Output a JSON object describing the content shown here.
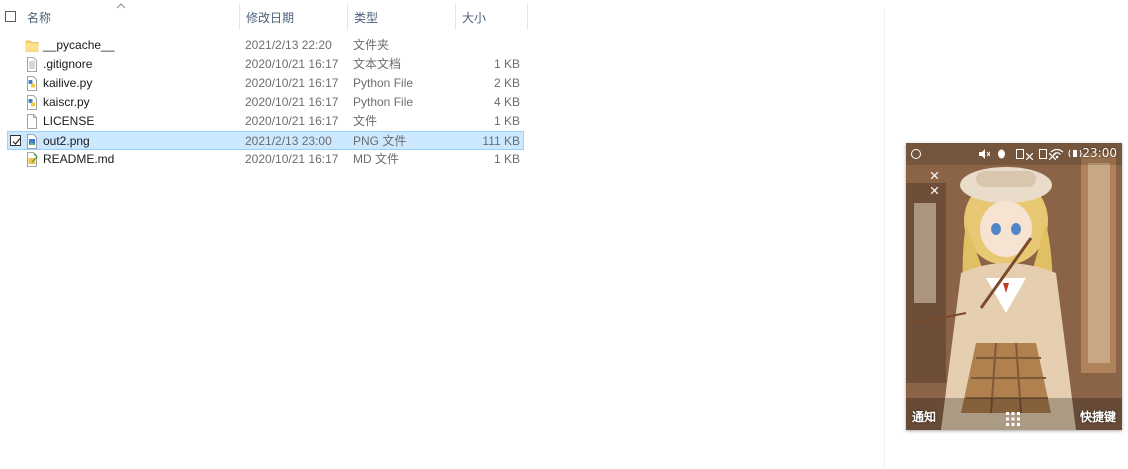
{
  "header": {
    "name": "名称",
    "date": "修改日期",
    "type": "类型",
    "size": "大小"
  },
  "files": [
    {
      "name": "__pycache__",
      "date": "2021/2/13 22:20",
      "type": "文件夹",
      "size": "",
      "icon": "folder-icon"
    },
    {
      "name": ".gitignore",
      "date": "2020/10/21 16:17",
      "type": "文本文档",
      "size": "1 KB",
      "icon": "text-file-icon"
    },
    {
      "name": "kailive.py",
      "date": "2020/10/21 16:17",
      "type": "Python File",
      "size": "2 KB",
      "icon": "python-file-icon"
    },
    {
      "name": "kaiscr.py",
      "date": "2020/10/21 16:17",
      "type": "Python File",
      "size": "4 KB",
      "icon": "python-file-icon"
    },
    {
      "name": "LICENSE",
      "date": "2020/10/21 16:17",
      "type": "文件",
      "size": "1 KB",
      "icon": "blank-file-icon"
    },
    {
      "name": "out2.png",
      "date": "2021/2/13 23:00",
      "type": "PNG 文件",
      "size": "111 KB",
      "icon": "image-file-icon",
      "selected": true
    },
    {
      "name": "README.md",
      "date": "2020/10/21 16:17",
      "type": "MD 文件",
      "size": "1 KB",
      "icon": "markdown-file-icon"
    }
  ],
  "preview": {
    "clock": "23:00",
    "left_softkey": "通知",
    "right_softkey": "快捷键"
  },
  "colors": {
    "selection_bg": "#cce8ff",
    "selection_border": "#99d1ff",
    "header_text": "#4c607a"
  }
}
